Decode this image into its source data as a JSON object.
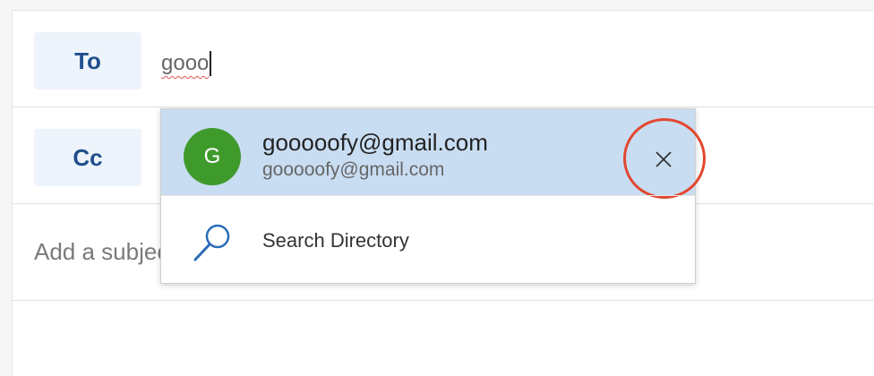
{
  "compose": {
    "to_label": "To",
    "to_value": "gooo",
    "cc_label": "Cc",
    "subject_placeholder": "Add a subject"
  },
  "dropdown": {
    "suggestion": {
      "avatar_letter": "G",
      "avatar_color": "#3f9a2c",
      "name": "gooooofy@gmail.com",
      "email": "gooooofy@gmail.com",
      "remove_icon": "close-icon"
    },
    "search_directory": {
      "icon": "search-icon",
      "label": "Search Directory"
    },
    "highlight_color": "#c9ddf2",
    "annotation_color": "#e2472f"
  }
}
